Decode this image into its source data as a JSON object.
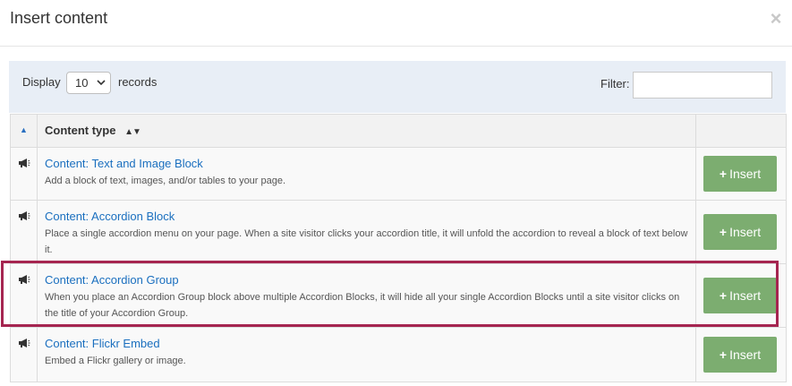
{
  "dialog": {
    "title": "Insert content",
    "close_symbol": "×"
  },
  "toolbar": {
    "display_label": "Display",
    "records_per_page": "10",
    "records_label": "records",
    "filter_label": "Filter:",
    "filter_value": ""
  },
  "table": {
    "sort_indicator": "▲",
    "header_content_type": "Content type",
    "sort_both_symbol": "▲▼",
    "rows": [
      {
        "title": "Content: Text and Image Block",
        "description": "Add a block of text, images, and/or tables to your page.",
        "button_label": "Insert",
        "icon": "megaphone-icon"
      },
      {
        "title": "Content: Accordion Block",
        "description": "Place a single accordion menu on your page. When a site visitor clicks your accordion title, it will unfold the accordion to reveal a block of text below it.",
        "button_label": "Insert",
        "icon": "megaphone-icon"
      },
      {
        "title": "Content: Accordion Group",
        "description": "When you place an Accordion Group block above multiple Accordion Blocks, it will hide all your single Accordion Blocks until a site visitor clicks on the title of your Accordion Group.",
        "button_label": "Insert",
        "icon": "megaphone-icon",
        "highlighted": true
      },
      {
        "title": "Content: Flickr Embed",
        "description": "Embed a Flickr gallery or image.",
        "button_label": "Insert",
        "icon": "megaphone-icon"
      }
    ]
  },
  "colors": {
    "link": "#1a6fbf",
    "insert_button": "#7cad70",
    "highlight_border": "#a52550",
    "toolbar_bg": "#e8eef6"
  }
}
